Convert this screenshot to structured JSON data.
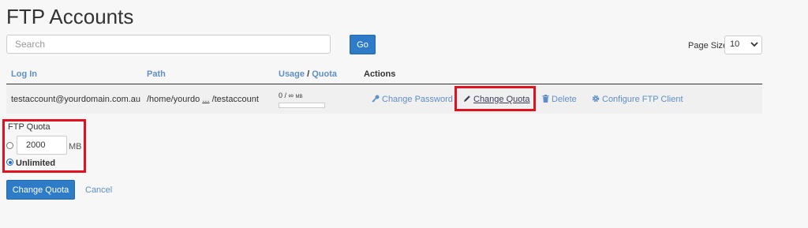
{
  "page": {
    "title": "FTP Accounts"
  },
  "search": {
    "placeholder": "Search",
    "go_label": "Go"
  },
  "pagesize": {
    "label": "Page Size",
    "value": "10"
  },
  "table": {
    "headers": {
      "login": "Log In",
      "path": "Path",
      "usage": "Usage",
      "slash": "/",
      "quota": "Quota",
      "actions": "Actions"
    },
    "row": {
      "login": "testaccount@yourdomain.com.au",
      "path_start": "/home/yourdo",
      "path_ellipsis": "...",
      "path_end": "/testaccount",
      "usage": "0 / ∞",
      "usage_unit": "MB",
      "usage_fraction": 0
    },
    "actions": {
      "change_password": "Change Password",
      "change_quota": "Change Quota",
      "delete": "Delete",
      "configure": "Configure FTP Client"
    }
  },
  "quota_form": {
    "label": "FTP Quota",
    "value": "2000",
    "unit": "MB",
    "unlimited": "Unlimited",
    "selected": "unlimited",
    "submit": "Change Quota",
    "cancel": "Cancel"
  },
  "colors": {
    "accent": "#2e7cc7",
    "link": "#5e8fc7",
    "highlight": "#e0121f"
  },
  "icons": {
    "change_password": "key-icon",
    "change_quota": "pencil-icon",
    "delete": "trash-icon",
    "configure": "gear-icon",
    "pagesize": "chevron-down-icon"
  }
}
